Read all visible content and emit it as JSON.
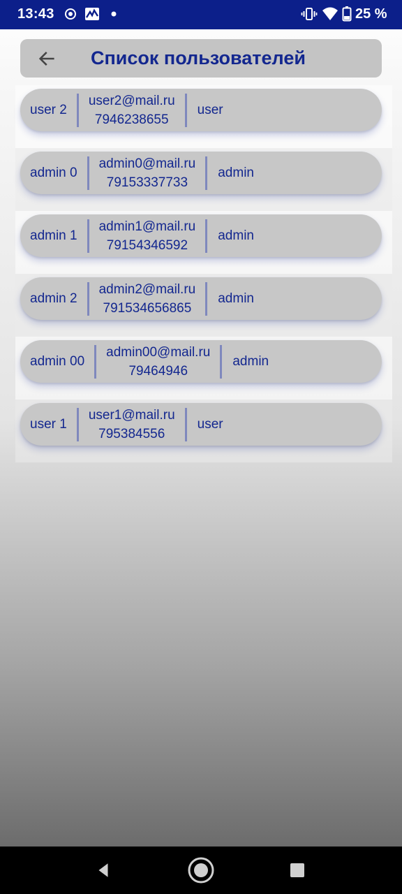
{
  "status_bar": {
    "time": "13:43",
    "battery": "25 %",
    "icons": [
      "focus-icon",
      "app-notification-icon",
      "notification-dot-icon",
      "vibrate-icon",
      "wifi-icon",
      "battery-icon"
    ]
  },
  "header": {
    "title": "Список пользователей",
    "back_icon": "arrow-left-icon"
  },
  "users": [
    {
      "name": "user 2",
      "email": "user2@mail.ru",
      "phone": "7946238655",
      "role": "user"
    },
    {
      "name": "admin 0",
      "email": "admin0@mail.ru",
      "phone": "79153337733",
      "role": "admin"
    },
    {
      "name": "admin 1",
      "email": "admin1@mail.ru",
      "phone": "79154346592",
      "role": "admin"
    },
    {
      "name": "admin 2",
      "email": "admin2@mail.ru",
      "phone": "791534656865",
      "role": "admin"
    },
    {
      "name": "admin 00",
      "email": "admin00@mail.ru",
      "phone": "79464946",
      "role": "admin"
    },
    {
      "name": "user 1",
      "email": "user1@mail.ru",
      "phone": "795384556",
      "role": "user"
    }
  ],
  "nav_bar": {
    "icons": [
      "back-triangle-icon",
      "home-circle-icon",
      "recents-square-icon"
    ]
  },
  "colors": {
    "status_bar": "#0c1f8a",
    "accent_text": "#13278f",
    "card": "#c7c7c7"
  }
}
